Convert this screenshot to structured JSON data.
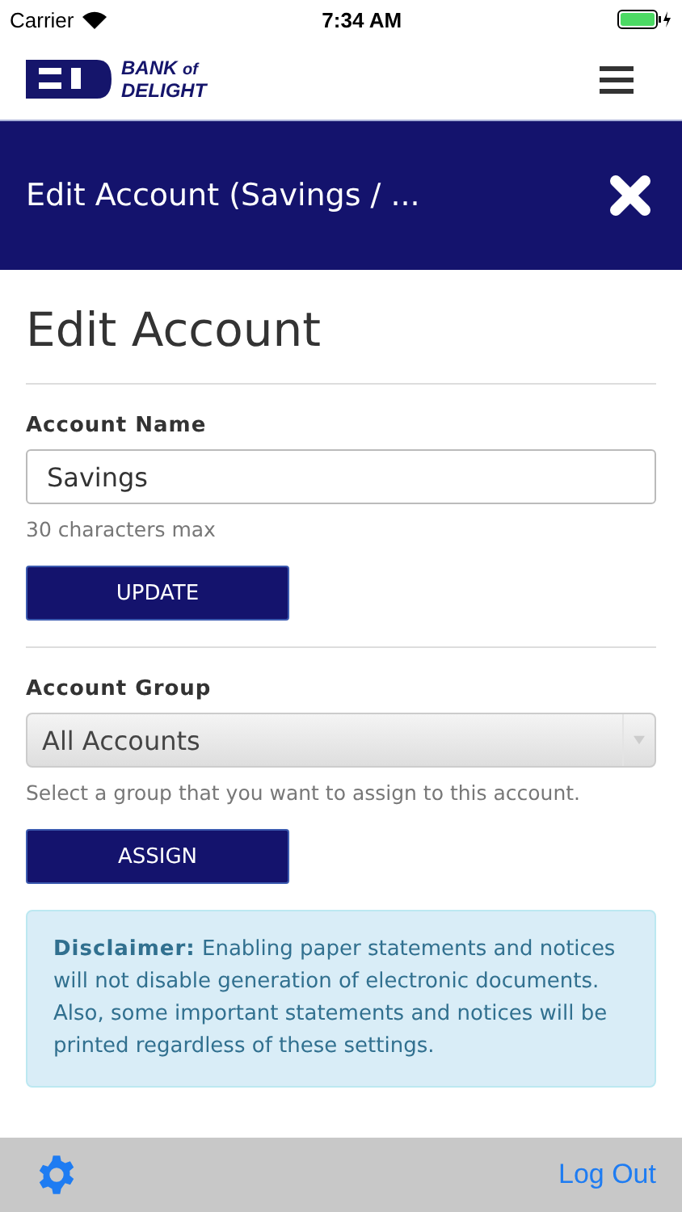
{
  "status_bar": {
    "carrier": "Carrier",
    "time": "7:34 AM"
  },
  "header": {
    "brand_top": "BANK",
    "brand_of": "of",
    "brand_bottom": "DELIGHT"
  },
  "banner": {
    "title": "Edit Account (Savings / ..."
  },
  "page_title": "Edit Account",
  "account_name": {
    "label": "Account Name",
    "value": "Savings",
    "hint": "30 characters max",
    "button": "UPDATE"
  },
  "account_group": {
    "label": "Account Group",
    "value": "All Accounts",
    "hint": "Select a group that you want to assign to this account.",
    "button": "ASSIGN"
  },
  "disclaimer": {
    "lead": "Disclaimer:",
    "text": "Enabling paper statements and notices will not disable generation of electronic documents. Also, some important statements and notices will be printed regardless of these settings."
  },
  "footer": {
    "logout": "Log Out"
  }
}
